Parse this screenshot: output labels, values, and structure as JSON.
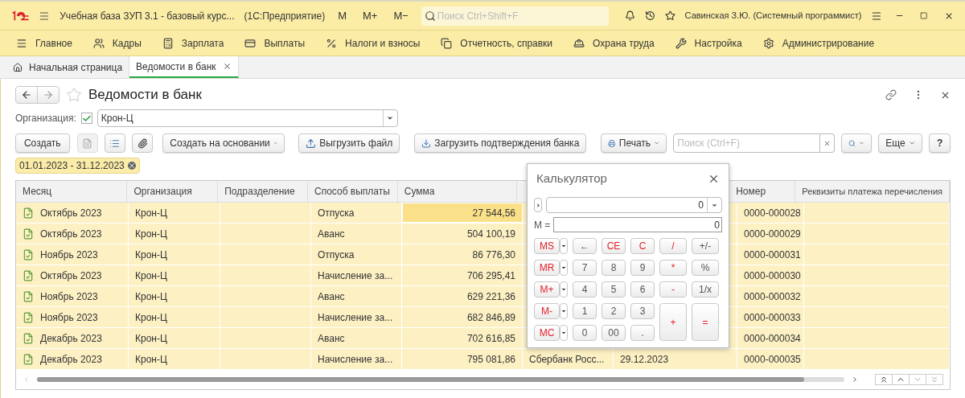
{
  "titlebar": {
    "title": "Учебная база ЗУП 3.1 - базовый курс...",
    "app": "(1С:Предприятие)",
    "memory_buttons": [
      "M",
      "M+",
      "M−"
    ],
    "search_placeholder": "Поиск Ctrl+Shift+F",
    "user": "Савинская З.Ю. (Системный программист)"
  },
  "nav": [
    {
      "label": "Главное",
      "kind": "menu"
    },
    {
      "label": "Кадры",
      "kind": "people"
    },
    {
      "label": "Зарплата",
      "kind": "calc"
    },
    {
      "label": "Выплаты",
      "kind": "card"
    },
    {
      "label": "Налоги и взносы",
      "kind": "percent"
    },
    {
      "label": "Отчетность, справки",
      "kind": "docs"
    },
    {
      "label": "Охрана труда",
      "kind": "helmet"
    },
    {
      "label": "Настройка",
      "kind": "wrench"
    },
    {
      "label": "Администрирование",
      "kind": "gear"
    }
  ],
  "tabs": [
    {
      "label": "Начальная страница",
      "selected": false,
      "kind": "home"
    },
    {
      "label": "Ведомости в банк",
      "selected": true,
      "kind": "doc"
    }
  ],
  "form": {
    "title": "Ведомости в банк",
    "org_label": "Организация:",
    "org_checked": true,
    "org_value": "Крон-Ц",
    "period": "01.01.2023 - 31.12.2023"
  },
  "toolbar": {
    "create": "Создать",
    "create_based": "Создать на основании",
    "export": "Выгрузить файл",
    "import": "Загрузить подтверждения банка",
    "print": "Печать",
    "search_placeholder": "Поиск (Ctrl+F)",
    "more": "Еще",
    "help": "?"
  },
  "table": {
    "columns": [
      "Месяц",
      "Организация",
      "Подразделение",
      "Способ выплаты",
      "Сумма",
      "",
      "",
      "Номер",
      "Реквизиты платежа перечисления"
    ],
    "rows": [
      {
        "month": "Октябрь 2023",
        "org": "Крон-Ц",
        "method": "Отпуска",
        "sum": "27 544,56",
        "number": "0000-000028",
        "selected": true
      },
      {
        "month": "Октябрь 2023",
        "org": "Крон-Ц",
        "method": "Аванс",
        "sum": "504 100,19",
        "number": "0000-000029",
        "selected": false
      },
      {
        "month": "Ноябрь 2023",
        "org": "Крон-Ц",
        "method": "Отпуска",
        "sum": "86 776,30",
        "number": "0000-000031",
        "selected": false
      },
      {
        "month": "Октябрь 2023",
        "org": "Крон-Ц",
        "method": "Начисление за...",
        "sum": "706 295,41",
        "number": "0000-000030",
        "selected": false
      },
      {
        "month": "Ноябрь 2023",
        "org": "Крон-Ц",
        "method": "Аванс",
        "sum": "629 221,36",
        "number": "0000-000032",
        "selected": false
      },
      {
        "month": "Ноябрь 2023",
        "org": "Крон-Ц",
        "method": "Начисление за...",
        "sum": "682 846,89",
        "number": "0000-000033",
        "selected": false
      },
      {
        "month": "Декабрь 2023",
        "org": "Крон-Ц",
        "method": "Аванс",
        "sum": "702 616,85",
        "number": "0000-000034",
        "selected": false
      },
      {
        "month": "Декабрь 2023",
        "org": "Крон-Ц",
        "method": "Начисление за...",
        "sum": "795 081,86",
        "column_6": "Сбербанк Росс...",
        "column_7": "29.12.2023",
        "number": "0000-000035",
        "selected": false
      }
    ]
  },
  "calculator": {
    "title": "Калькулятор",
    "display": "0",
    "memory_label": "M =",
    "memory": "0",
    "buttons": [
      {
        "label": "MS",
        "kind": "memory"
      },
      {
        "label": "←",
        "kind": "key",
        "accent": false
      },
      {
        "label": "CE",
        "kind": "key",
        "accent": true
      },
      {
        "label": "C",
        "kind": "key",
        "accent": true
      },
      {
        "label": "/",
        "kind": "op",
        "accent": true
      },
      {
        "label": "+/-",
        "kind": "op",
        "accent": false
      },
      {
        "label": "MR",
        "kind": "memory"
      },
      {
        "label": "7",
        "kind": "key",
        "accent": false
      },
      {
        "label": "8",
        "kind": "key",
        "accent": false
      },
      {
        "label": "9",
        "kind": "key",
        "accent": false
      },
      {
        "label": "*",
        "kind": "op",
        "accent": true
      },
      {
        "label": "%",
        "kind": "op",
        "accent": false
      },
      {
        "label": "M+",
        "kind": "memory"
      },
      {
        "label": "4",
        "kind": "key",
        "accent": false
      },
      {
        "label": "5",
        "kind": "key",
        "accent": false
      },
      {
        "label": "6",
        "kind": "key",
        "accent": false
      },
      {
        "label": "-",
        "kind": "op",
        "accent": true
      },
      {
        "label": "1/x",
        "kind": "op",
        "accent": false
      },
      {
        "label": "M-",
        "kind": "memory"
      },
      {
        "label": "1",
        "kind": "key",
        "accent": false
      },
      {
        "label": "2",
        "kind": "key",
        "accent": false
      },
      {
        "label": "3",
        "kind": "key",
        "accent": false
      },
      {
        "label": "+",
        "kind": "tall",
        "accent": true
      },
      {
        "label": "=",
        "kind": "tall",
        "accent": true
      },
      {
        "label": "MC",
        "kind": "memory"
      },
      {
        "label": "0",
        "kind": "key",
        "accent": false
      },
      {
        "label": "00",
        "kind": "key",
        "accent": false
      },
      {
        "label": ".",
        "kind": "key",
        "accent": false
      }
    ]
  }
}
